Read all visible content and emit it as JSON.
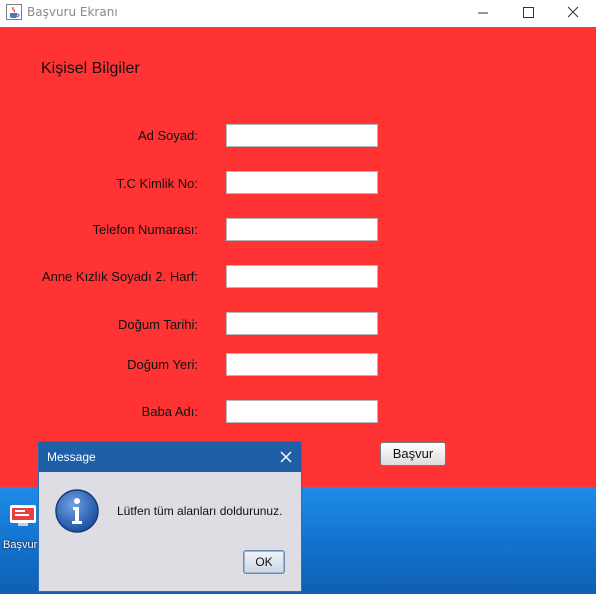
{
  "window": {
    "title": "Başvuru Ekranı",
    "background_color": "#ff3333",
    "icon": "java-cup-icon"
  },
  "form": {
    "section_title": "Kişisel Bilgiler",
    "fields": [
      {
        "label": "Ad Soyad:",
        "value": ""
      },
      {
        "label": "T.C Kimlik No:",
        "value": ""
      },
      {
        "label": "Telefon Numarası:",
        "value": ""
      },
      {
        "label": "Anne Kızlık Soyadı 2. Harf:",
        "value": ""
      },
      {
        "label": "Doğum Tarihi:",
        "value": ""
      },
      {
        "label": "Doğum Yeri:",
        "value": ""
      },
      {
        "label": "Baba Adı:",
        "value": ""
      }
    ],
    "submit_label": "Başvur"
  },
  "desktop": {
    "icon_label": "Başvur",
    "icon": "app-shortcut-icon"
  },
  "dialog": {
    "title": "Message",
    "message": "Lütfen tüm alanları doldurunuz.",
    "ok_label": "OK",
    "icon": "info-icon",
    "titlebar_color": "#1f5fa8"
  }
}
